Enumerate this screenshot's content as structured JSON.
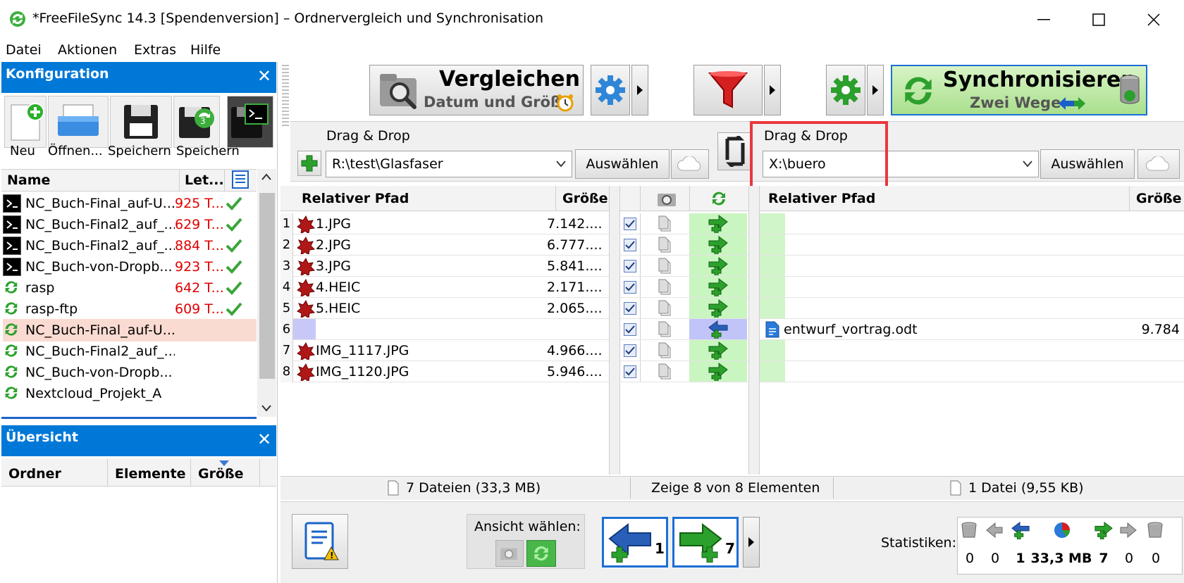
{
  "window": {
    "title": "*FreeFileSync 14.3 [Spendenversion] – Ordnervergleich und Synchronisation",
    "minimize_glyph": "—",
    "maximize_glyph": "☐",
    "close_glyph": "✕"
  },
  "menu": [
    "Datei",
    "Aktionen",
    "Extras",
    "Hilfe"
  ],
  "config_panel": {
    "title": "Konfiguration",
    "close_glyph": "✕",
    "toolbar": [
      "Neu",
      "Öffnen...",
      "Speichern",
      "Speichern"
    ],
    "col_name": "Name",
    "col_last": "Let...",
    "items": [
      {
        "icon": "terminal-icon",
        "name": "NC_Buch-Final_auf-U...",
        "last": "925 T...",
        "ok": true
      },
      {
        "icon": "terminal-icon",
        "name": "NC_Buch-Final2_auf_...",
        "last": "629 T...",
        "ok": true
      },
      {
        "icon": "terminal-icon",
        "name": "NC_Buch-Final2_auf_...",
        "last": "884 T...",
        "ok": true
      },
      {
        "icon": "terminal-icon",
        "name": "NC_Buch-von-Dropb...",
        "last": "923 T...",
        "ok": true
      },
      {
        "icon": "sync-icon",
        "name": "rasp",
        "last": "642 T...",
        "ok": true
      },
      {
        "icon": "sync-icon",
        "name": "rasp-ftp",
        "last": "609 T...",
        "ok": true
      },
      {
        "icon": "sync-icon",
        "name": "NC_Buch-Final_auf-U...",
        "last": "",
        "ok": false,
        "selected": true
      },
      {
        "icon": "sync-icon",
        "name": "NC_Buch-Final2_auf_...",
        "last": "",
        "ok": false
      },
      {
        "icon": "sync-icon",
        "name": "NC_Buch-von-Dropb...",
        "last": "",
        "ok": false
      },
      {
        "icon": "sync-icon",
        "name": "Nextcloud_Projekt_A",
        "last": "",
        "ok": false
      }
    ]
  },
  "overview_panel": {
    "title": "Übersicht",
    "close_glyph": "✕",
    "col_folder": "Ordner",
    "col_elements": "Elemente",
    "col_size": "Größe"
  },
  "toolbar": {
    "compare_label": "Vergleichen",
    "compare_sub": "Datum und Größe",
    "sync_label": "Synchronisieren",
    "sync_sub": "Zwei Wege"
  },
  "left_folder": {
    "drag_drop": "Drag & Drop",
    "path": "R:\\test\\Glasfaser",
    "browse": "Auswählen"
  },
  "right_folder": {
    "drag_drop": "Drag & Drop",
    "path": "X:\\buero",
    "browse": "Auswählen"
  },
  "grid": {
    "col_path": "Relativer Pfad",
    "col_size": "Größe",
    "left_rows": [
      {
        "n": "1",
        "name": "1.JPG",
        "size": "7.142...."
      },
      {
        "n": "2",
        "name": "2.JPG",
        "size": "6.777...."
      },
      {
        "n": "3",
        "name": "3.JPG",
        "size": "5.841...."
      },
      {
        "n": "4",
        "name": "4.HEIC",
        "size": "2.171...."
      },
      {
        "n": "5",
        "name": "5.HEIC",
        "size": "2.065...."
      },
      {
        "n": "6",
        "name": "",
        "size": ""
      },
      {
        "n": "7",
        "name": "IMG_1117.JPG",
        "size": "4.966...."
      },
      {
        "n": "8",
        "name": "IMG_1120.JPG",
        "size": "5.946...."
      }
    ],
    "right_rows": [
      {
        "name": "",
        "size": ""
      },
      {
        "name": "",
        "size": ""
      },
      {
        "name": "",
        "size": ""
      },
      {
        "name": "",
        "size": ""
      },
      {
        "name": "",
        "size": ""
      },
      {
        "name": "entwurf_vortrag.odt",
        "size": "9.784"
      },
      {
        "name": "",
        "size": ""
      },
      {
        "name": "",
        "size": ""
      }
    ],
    "actions": [
      "create-right",
      "create-right",
      "create-right",
      "create-right",
      "create-right",
      "create-left",
      "create-right",
      "create-right"
    ]
  },
  "status": {
    "left": "7 Dateien (33,3 MB)",
    "middle": "Zeige 8 von 8 Elementen",
    "right": "1 Datei (9,55 KB)"
  },
  "bottom": {
    "view_label": "Ansicht wählen:",
    "create_left_count": "1",
    "create_right_count": "7",
    "stats_label": "Statistiken:",
    "stats": [
      "0",
      "0",
      "1",
      "33,3 MB",
      "7",
      "0",
      "0"
    ]
  },
  "colors": {
    "accent": "#0078d7",
    "red_text": "#e00000",
    "green_action": "#c8f5c0",
    "highlight_box": "#e8383d"
  }
}
